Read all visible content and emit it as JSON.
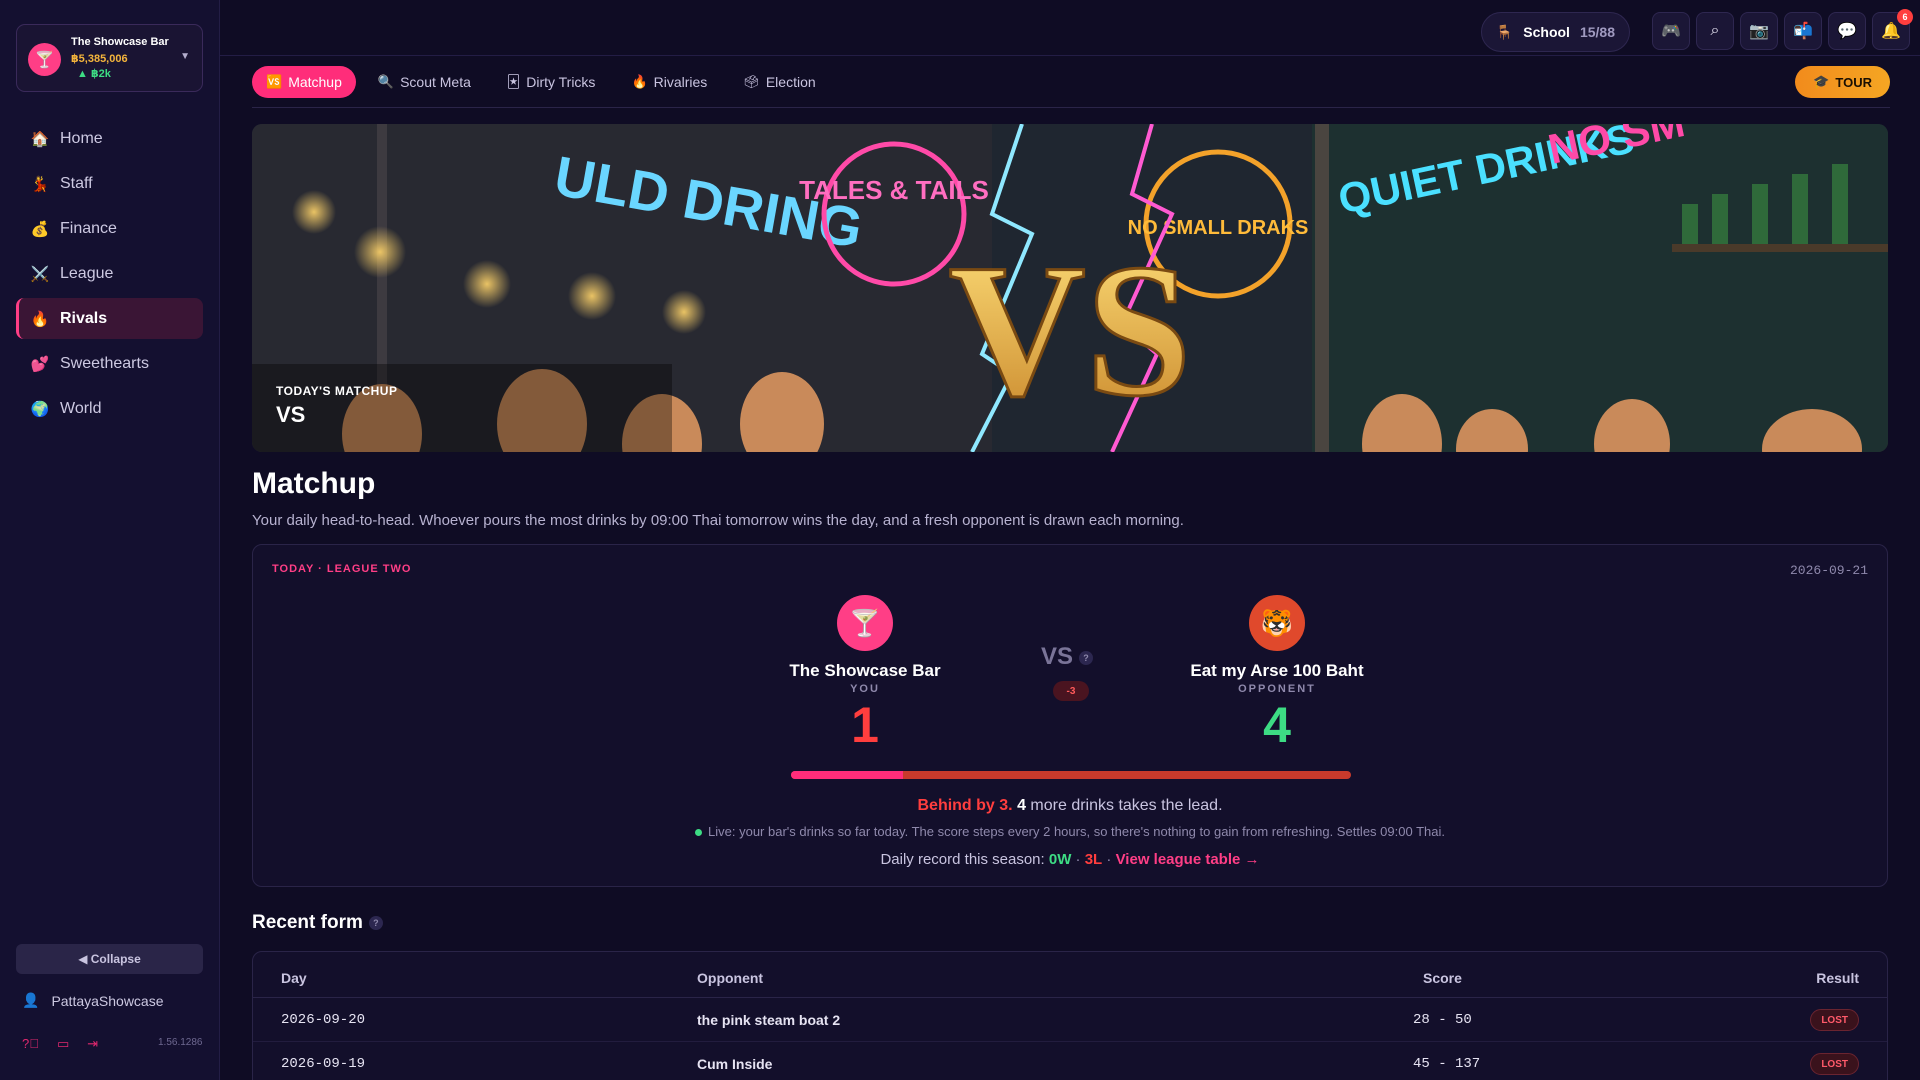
{
  "venue": {
    "name": "The Showcase Bar",
    "cash": "฿5,385,006",
    "gain": "▲ ฿2k",
    "logo_icon": "🍸"
  },
  "nav": [
    {
      "icon": "🏠",
      "label": "Home"
    },
    {
      "icon": "💃",
      "label": "Staff"
    },
    {
      "icon": "💰",
      "label": "Finance"
    },
    {
      "icon": "⚔️",
      "label": "League"
    },
    {
      "icon": "🔥",
      "label": "Rivals"
    },
    {
      "icon": "💕",
      "label": "Sweethearts"
    },
    {
      "icon": "🌍",
      "label": "World"
    }
  ],
  "sidebar": {
    "collapse_label": "◀ Collapse",
    "user": "PattayaShowcase",
    "version": "1.56.1286"
  },
  "topbar": {
    "school_label": "School",
    "school_count": "15/88",
    "notifications_count": "6"
  },
  "tabs": [
    {
      "icon": "🆚",
      "label": "Matchup"
    },
    {
      "icon": "🔍",
      "label": "Scout Meta"
    },
    {
      "icon": "🃏",
      "label": "Dirty Tricks"
    },
    {
      "icon": "🔥",
      "label": "Rivalries"
    },
    {
      "icon": "🗳",
      "label": "Election"
    }
  ],
  "tour_label": "TOUR",
  "hero": {
    "kicker": "TODAY'S MATCHUP",
    "title": "VS",
    "signs": [
      "ULD DRING",
      "TALES & TAILS",
      "VS",
      "NO SMALL DRAKS",
      "QUIET DRINKS",
      "NO SM"
    ]
  },
  "page": {
    "title": "Matchup",
    "description": "Your daily head-to-head. Whoever pours the most drinks by 09:00 Thai tomorrow wins the day, and a fresh opponent is drawn each morning."
  },
  "matchup": {
    "kicker": "TODAY · LEAGUE TWO",
    "date": "2026-09-21",
    "you": {
      "name": "The Showcase Bar",
      "role": "YOU",
      "score": "1",
      "icon": "🍸",
      "color": "#ff3e86"
    },
    "opponent": {
      "name": "Eat my Arse 100 Baht",
      "role": "OPPONENT",
      "score": "4",
      "icon": "🐯",
      "color": "#e0492c"
    },
    "vs": "VS",
    "diff": "-3",
    "progress_share": 0.2,
    "behind_text": "Behind by 3.",
    "more_count": "4",
    "more_text": " more drinks takes the lead.",
    "live_text": "Live: your bar's drinks so far today. The score steps every 2 hours, so there's nothing to gain from refreshing. Settles 09:00 Thai.",
    "record_label": "Daily record this season:",
    "record_w": "0W",
    "record_l": "3L",
    "record_link": "View league table →"
  },
  "recent_form": {
    "title": "Recent form",
    "columns": [
      "Day",
      "Opponent",
      "Score",
      "Result"
    ],
    "rows": [
      {
        "day": "2026-09-20",
        "opponent": "the pink steam boat 2",
        "score": "28 - 50",
        "result": "LOST"
      },
      {
        "day": "2026-09-19",
        "opponent": "Cum Inside",
        "score": "45 - 137",
        "result": "LOST"
      }
    ]
  },
  "colors": {
    "accent": "#ff2d7a",
    "win": "#3ddc84",
    "loss": "#ff3e3e",
    "bg": "#0f0c24"
  }
}
